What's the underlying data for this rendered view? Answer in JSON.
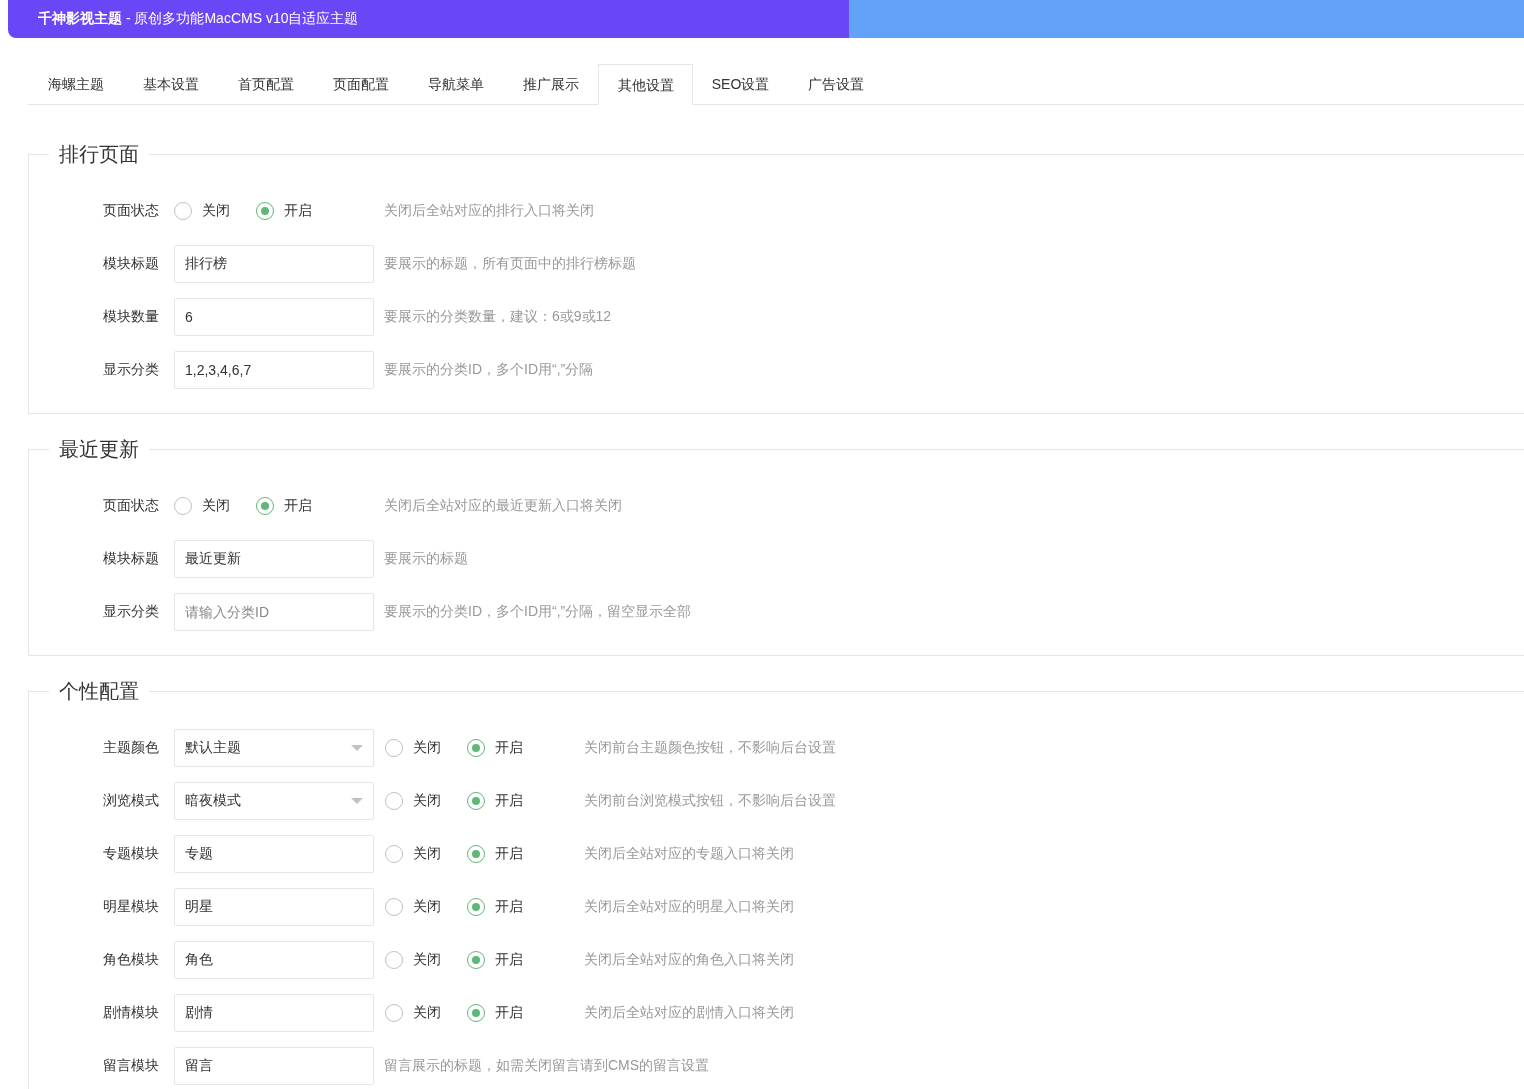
{
  "header": {
    "title": "**千神影视主题** - 原创多功能MacCMS v10自适应主题"
  },
  "tabs": [
    {
      "label": "海螺主题",
      "selected": false
    },
    {
      "label": "基本设置",
      "selected": false
    },
    {
      "label": "首页配置",
      "selected": false
    },
    {
      "label": "页面配置",
      "selected": false
    },
    {
      "label": "导航菜单",
      "selected": false
    },
    {
      "label": "推广展示",
      "selected": false
    },
    {
      "label": "其他设置",
      "selected": true
    },
    {
      "label": "SEO设置",
      "selected": false
    },
    {
      "label": "广告设置",
      "selected": false
    }
  ],
  "sections": [
    {
      "title": "排行页面",
      "rows": [
        {
          "kind": "radio",
          "label": "页面状态",
          "options": [
            {
              "label": "关闭",
              "selected": false
            },
            {
              "label": "开启",
              "selected": true
            }
          ],
          "hint": "关闭后全站对应的排行入口将关闭"
        },
        {
          "kind": "input",
          "label": "模块标题",
          "value": "排行榜",
          "hint": "要展示的标题，所有页面中的排行榜标题"
        },
        {
          "kind": "input",
          "label": "模块数量",
          "value": "6",
          "hint": "要展示的分类数量，建议：6或9或12"
        },
        {
          "kind": "input",
          "label": "显示分类",
          "value": "1,2,3,4,6,7",
          "hint": "要展示的分类ID，多个ID用“,”分隔"
        }
      ]
    },
    {
      "title": "最近更新",
      "rows": [
        {
          "kind": "radio",
          "label": "页面状态",
          "options": [
            {
              "label": "关闭",
              "selected": false
            },
            {
              "label": "开启",
              "selected": true
            }
          ],
          "hint": "关闭后全站对应的最近更新入口将关闭"
        },
        {
          "kind": "input",
          "label": "模块标题",
          "value": "最近更新",
          "hint": "要展示的标题"
        },
        {
          "kind": "input",
          "label": "显示分类",
          "placeholder": "请输入分类ID",
          "hint": "要展示的分类ID，多个ID用“,”分隔，留空显示全部"
        }
      ]
    },
    {
      "title": "个性配置",
      "rows": [
        {
          "kind": "select",
          "label": "主题颜色",
          "value": "默认主题",
          "options": [
            {
              "label": "关闭",
              "selected": false
            },
            {
              "label": "开启",
              "selected": true
            }
          ],
          "hint": "关闭前台主题颜色按钮，不影响后台设置"
        },
        {
          "kind": "select",
          "label": "浏览模式",
          "value": "暗夜模式",
          "options": [
            {
              "label": "关闭",
              "selected": false
            },
            {
              "label": "开启",
              "selected": true
            }
          ],
          "hint": "关闭前台浏览模式按钮，不影响后台设置"
        },
        {
          "kind": "input",
          "label": "专题模块",
          "value": "专题",
          "options": [
            {
              "label": "关闭",
              "selected": false
            },
            {
              "label": "开启",
              "selected": true
            }
          ],
          "hint": "关闭后全站对应的专题入口将关闭"
        },
        {
          "kind": "input",
          "label": "明星模块",
          "value": "明星",
          "options": [
            {
              "label": "关闭",
              "selected": false
            },
            {
              "label": "开启",
              "selected": true
            }
          ],
          "hint": "关闭后全站对应的明星入口将关闭"
        },
        {
          "kind": "input",
          "label": "角色模块",
          "value": "角色",
          "options": [
            {
              "label": "关闭",
              "selected": false
            },
            {
              "label": "开启",
              "selected": true
            }
          ],
          "hint": "关闭后全站对应的角色入口将关闭"
        },
        {
          "kind": "input",
          "label": "剧情模块",
          "value": "剧情",
          "options": [
            {
              "label": "关闭",
              "selected": false
            },
            {
              "label": "开启",
              "selected": true
            }
          ],
          "hint": "关闭后全站对应的剧情入口将关闭"
        },
        {
          "kind": "input",
          "label": "留言模块",
          "value": "留言",
          "hint": "留言展示的标题，如需关闭留言请到CMS的留言设置"
        }
      ]
    }
  ]
}
